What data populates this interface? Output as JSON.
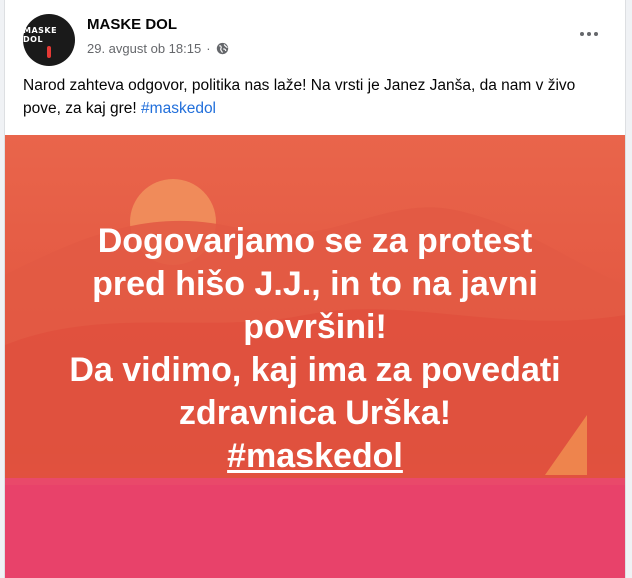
{
  "post": {
    "page_name": "MASKE DOL",
    "avatar_text": "MASKE DOL",
    "timestamp": "29. avgust ob 18:15",
    "separator": "·",
    "privacy_icon": "globe-icon",
    "more_icon": "more-options-icon",
    "text": "Narod zahteva odgovor, politika nas laže! Na vrsti je Janez Janša, da nam v živo pove, za kaj gre! ",
    "hashtag": "#maskedol"
  },
  "image": {
    "lines": [
      "Dogovarjamo se za protest",
      "pred hišo J.J., in to na javni",
      "površini!",
      "Da vidimo, kaj ima za povedati",
      "zdravnica Urška!"
    ],
    "hashtag": "#maskedol",
    "colors": {
      "top": "#e9654b",
      "middle": "#e0503c",
      "bottom": "#e8426a",
      "sun": "#f08b5a"
    }
  }
}
